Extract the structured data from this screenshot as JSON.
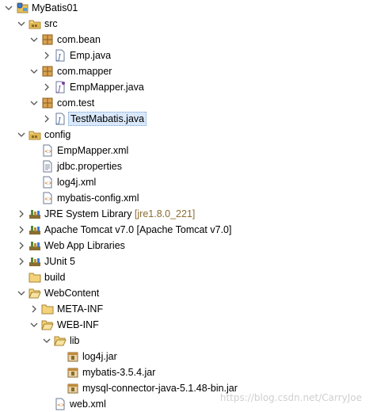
{
  "tree": [
    {
      "name": "project-mybatis01",
      "label": "MyBatis01",
      "icon": "project-icon",
      "arrow": "expanded",
      "depth": 0
    },
    {
      "name": "folder-src",
      "label": "src",
      "icon": "source-folder-icon",
      "arrow": "expanded",
      "depth": 1
    },
    {
      "name": "package-com-bean",
      "label": "com.bean",
      "icon": "package-icon",
      "arrow": "expanded",
      "depth": 2
    },
    {
      "name": "file-emp-java",
      "label": "Emp.java",
      "icon": "java-file-icon",
      "arrow": "collapsed",
      "depth": 3
    },
    {
      "name": "package-com-mapper",
      "label": "com.mapper",
      "icon": "package-icon",
      "arrow": "expanded",
      "depth": 2
    },
    {
      "name": "file-empmapper-java",
      "label": "EmpMapper.java",
      "icon": "java-interface-file-icon",
      "arrow": "collapsed",
      "depth": 3
    },
    {
      "name": "package-com-test",
      "label": "com.test",
      "icon": "package-icon",
      "arrow": "expanded",
      "depth": 2
    },
    {
      "name": "file-testmabatis-java",
      "label": "TestMabatis.java",
      "icon": "java-file-icon",
      "arrow": "collapsed",
      "depth": 3,
      "selected": true
    },
    {
      "name": "folder-config",
      "label": "config",
      "icon": "source-folder-icon",
      "arrow": "expanded",
      "depth": 1
    },
    {
      "name": "file-empmapper-xml",
      "label": "EmpMapper.xml",
      "icon": "xml-file-icon",
      "arrow": "none",
      "depth": 2
    },
    {
      "name": "file-jdbc-properties",
      "label": "jdbc.properties",
      "icon": "properties-file-icon",
      "arrow": "none",
      "depth": 2
    },
    {
      "name": "file-log4j-xml",
      "label": "log4j.xml",
      "icon": "xml-file-icon",
      "arrow": "none",
      "depth": 2
    },
    {
      "name": "file-mybatis-config-xml",
      "label": "mybatis-config.xml",
      "icon": "xml-file-icon",
      "arrow": "none",
      "depth": 2
    },
    {
      "name": "library-jre",
      "label": "JRE System Library",
      "decoration": "[jre1.8.0_221]",
      "icon": "library-icon",
      "arrow": "collapsed",
      "depth": 1
    },
    {
      "name": "library-tomcat",
      "label": "Apache Tomcat v7.0 [Apache Tomcat v7.0]",
      "icon": "library-icon",
      "arrow": "collapsed",
      "depth": 1
    },
    {
      "name": "library-web-app",
      "label": "Web App Libraries",
      "icon": "library-icon",
      "arrow": "collapsed",
      "depth": 1
    },
    {
      "name": "library-junit5",
      "label": "JUnit 5",
      "icon": "library-icon",
      "arrow": "collapsed",
      "depth": 1
    },
    {
      "name": "folder-build",
      "label": "build",
      "icon": "folder-icon",
      "arrow": "none",
      "depth": 1
    },
    {
      "name": "folder-webcontent",
      "label": "WebContent",
      "icon": "folder-open-icon",
      "arrow": "expanded",
      "depth": 1
    },
    {
      "name": "folder-meta-inf",
      "label": "META-INF",
      "icon": "folder-icon",
      "arrow": "collapsed",
      "depth": 2
    },
    {
      "name": "folder-web-inf",
      "label": "WEB-INF",
      "icon": "folder-open-icon",
      "arrow": "expanded",
      "depth": 2
    },
    {
      "name": "folder-lib",
      "label": "lib",
      "icon": "folder-open-icon",
      "arrow": "expanded",
      "depth": 3
    },
    {
      "name": "file-log4j-jar",
      "label": "log4j.jar",
      "icon": "jar-file-icon",
      "arrow": "none",
      "depth": 4
    },
    {
      "name": "file-mybatis-jar",
      "label": "mybatis-3.5.4.jar",
      "icon": "jar-file-icon",
      "arrow": "none",
      "depth": 4
    },
    {
      "name": "file-mysql-connector-jar",
      "label": "mysql-connector-java-5.1.48-bin.jar",
      "icon": "jar-file-icon",
      "arrow": "none",
      "depth": 4
    },
    {
      "name": "file-web-xml",
      "label": "web.xml",
      "icon": "xml-file-icon",
      "arrow": "none",
      "depth": 3
    }
  ],
  "watermark": "https://blog.csdn.net/CarryJoe",
  "colors": {
    "selection_bg": "#d9e8fb",
    "decoration_text": "#8a6c2f",
    "folder_yellow": "#e8c15a",
    "package_brown": "#c28a3a",
    "library_green": "#4e8a3a"
  }
}
